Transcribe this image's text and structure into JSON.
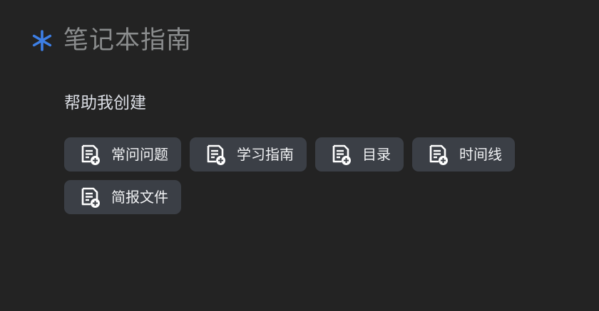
{
  "header": {
    "title": "笔记本指南",
    "icon": "asterisk-icon",
    "icon_color": "#3d7fe6"
  },
  "section": {
    "subtitle": "帮助我创建"
  },
  "actions": [
    {
      "label": "常问问题",
      "icon": "add-note-icon"
    },
    {
      "label": "学习指南",
      "icon": "add-note-icon"
    },
    {
      "label": "目录",
      "icon": "add-note-icon"
    },
    {
      "label": "时间线",
      "icon": "add-note-icon"
    },
    {
      "label": "简报文件",
      "icon": "add-note-icon"
    }
  ],
  "colors": {
    "background": "#232323",
    "chip_background": "#3b3f46",
    "title_text": "#8a8c8d",
    "chip_text": "#f2f3f5"
  }
}
